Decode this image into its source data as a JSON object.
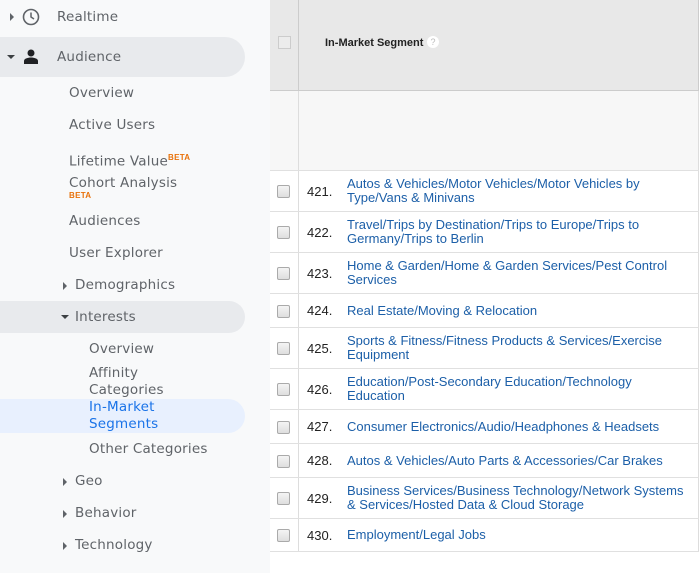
{
  "sidebar": {
    "realtime": "Realtime",
    "audience": "Audience",
    "items": {
      "overview": "Overview",
      "active_users": "Active Users",
      "lifetime_value": "Lifetime Value",
      "cohort_analysis": "Cohort Analysis",
      "audiences": "Audiences",
      "user_explorer": "User Explorer",
      "demographics": "Demographics",
      "interests": "Interests",
      "geo": "Geo",
      "behavior": "Behavior",
      "technology": "Technology"
    },
    "beta_badge": "BETA",
    "interests_items": {
      "overview": "Overview",
      "affinity_1": "Affinity",
      "affinity_2": "Categories",
      "inmarket_1": "In-Market",
      "inmarket_2": "Segments",
      "other": "Other Categories"
    },
    "selected": "In-Market Segments"
  },
  "table": {
    "column_header": "In-Market Segment",
    "help_icon": "?",
    "rows": [
      {
        "num": "421.",
        "label": "Autos & Vehicles/Motor Vehicles/Motor Vehicles by Type/Vans & Minivans"
      },
      {
        "num": "422.",
        "label": "Travel/Trips by Destination/Trips to Europe/Trips to Germany/Trips to Berlin"
      },
      {
        "num": "423.",
        "label": "Home & Garden/Home & Garden Services/Pest Control Services"
      },
      {
        "num": "424.",
        "label": "Real Estate/Moving & Relocation"
      },
      {
        "num": "425.",
        "label": "Sports & Fitness/Fitness Products & Services/Exercise Equipment"
      },
      {
        "num": "426.",
        "label": "Education/Post-Secondary Education/Technology Education"
      },
      {
        "num": "427.",
        "label": "Consumer Electronics/Audio/Headphones & Headsets"
      },
      {
        "num": "428.",
        "label": "Autos & Vehicles/Auto Parts & Accessories/Car Brakes"
      },
      {
        "num": "429.",
        "label": "Business Services/Business Technology/Network Systems & Services/Hosted Data & Cloud Storage"
      },
      {
        "num": "430.",
        "label": "Employment/Legal Jobs"
      }
    ]
  },
  "colors": {
    "link": "#1c5fa8",
    "selected": "#1a73e8",
    "beta": "#e8710a"
  }
}
